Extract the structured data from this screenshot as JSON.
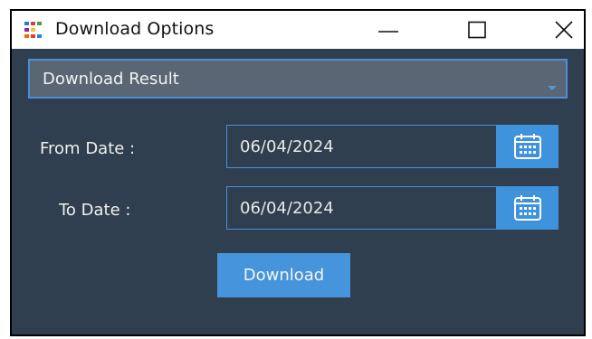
{
  "window": {
    "title": "Download Options",
    "controls": [
      "minimize",
      "maximize",
      "close"
    ]
  },
  "dropdown": {
    "selected": "Download Result"
  },
  "form": {
    "from_label": "From Date :",
    "from_value": "06/04/2024",
    "to_label": "To Date :",
    "to_value": "06/04/2024"
  },
  "actions": {
    "download_label": "Download"
  },
  "colors": {
    "background": "#2f3f4f",
    "accent": "#4594dc",
    "dropdown_bg": "#5a6673"
  },
  "icons": {
    "app": "app-logo-icon",
    "calendar": "calendar-icon"
  }
}
